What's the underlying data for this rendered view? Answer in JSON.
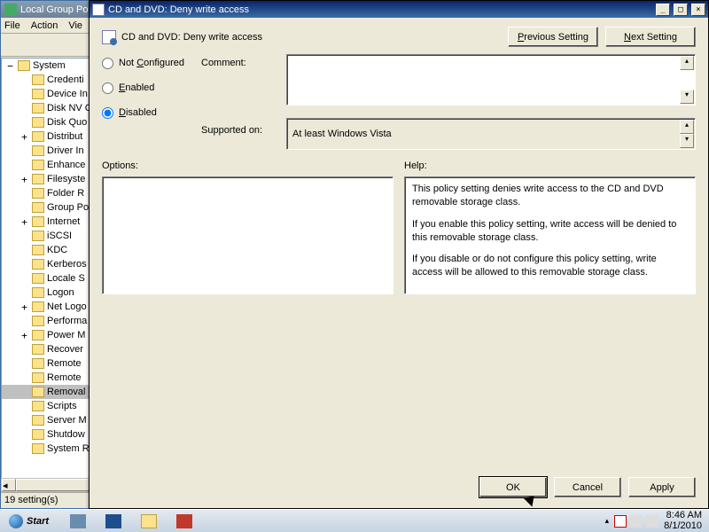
{
  "mmc": {
    "title": "Local Group Po",
    "menu": [
      "File",
      "Action",
      "Vie"
    ],
    "tree_root": "System",
    "tree_items": [
      {
        "exp": "",
        "label": "Credenti"
      },
      {
        "exp": "",
        "label": "Device In"
      },
      {
        "exp": "",
        "label": "Disk NV C"
      },
      {
        "exp": "",
        "label": "Disk Quo"
      },
      {
        "exp": "+",
        "label": "Distribut"
      },
      {
        "exp": "",
        "label": "Driver In"
      },
      {
        "exp": "",
        "label": "Enhance"
      },
      {
        "exp": "+",
        "label": "Filesyste"
      },
      {
        "exp": "",
        "label": "Folder R"
      },
      {
        "exp": "",
        "label": "Group Po"
      },
      {
        "exp": "+",
        "label": "Internet"
      },
      {
        "exp": "",
        "label": "iSCSI"
      },
      {
        "exp": "",
        "label": "KDC"
      },
      {
        "exp": "",
        "label": "Kerberos"
      },
      {
        "exp": "",
        "label": "Locale S"
      },
      {
        "exp": "",
        "label": "Logon"
      },
      {
        "exp": "+",
        "label": "Net Logo"
      },
      {
        "exp": "",
        "label": "Performa"
      },
      {
        "exp": "+",
        "label": "Power M"
      },
      {
        "exp": "",
        "label": "Recover"
      },
      {
        "exp": "",
        "label": "Remote"
      },
      {
        "exp": "",
        "label": "Remote"
      },
      {
        "exp": "",
        "label": "Removal",
        "sel": true
      },
      {
        "exp": "",
        "label": "Scripts"
      },
      {
        "exp": "",
        "label": "Server M"
      },
      {
        "exp": "",
        "label": "Shutdow"
      },
      {
        "exp": "",
        "label": "System R"
      }
    ],
    "status": "19 setting(s)"
  },
  "dialog": {
    "title": "CD and DVD: Deny write access",
    "header": "CD and DVD: Deny write access",
    "nav": {
      "prev": "Previous Setting",
      "next": "Next Setting"
    },
    "radios": {
      "not_configured": "Not Configured",
      "enabled": "Enabled",
      "disabled": "Disabled",
      "selected": "disabled"
    },
    "labels": {
      "comment": "Comment:",
      "supported": "Supported on:",
      "options": "Options:",
      "help": "Help:"
    },
    "comment_text": "",
    "supported_text": "At least Windows Vista",
    "help_text": "This policy setting denies write access to the CD and DVD removable storage class.\n\nIf you enable this policy setting, write access will be denied to this removable storage class.\n\nIf you disable or do not configure this policy setting, write access will be allowed to this removable storage class.",
    "buttons": {
      "ok": "OK",
      "cancel": "Cancel",
      "apply": "Apply"
    }
  },
  "taskbar": {
    "start": "Start",
    "time": "8:46 AM",
    "date": "8/1/2010"
  }
}
